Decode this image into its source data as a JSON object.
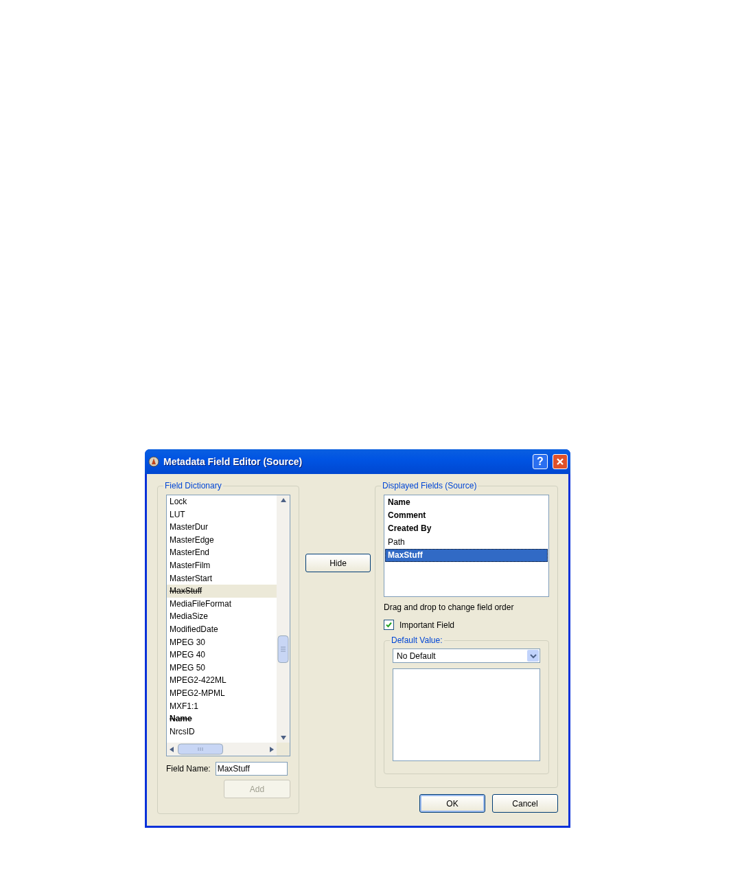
{
  "window": {
    "title": "Metadata Field Editor (Source)",
    "help_button": "?"
  },
  "field_dictionary": {
    "label": "Field Dictionary",
    "items": [
      {
        "text": "Lock",
        "bold": false,
        "struck": false,
        "selected": false
      },
      {
        "text": "LUT",
        "bold": false,
        "struck": false,
        "selected": false
      },
      {
        "text": "MasterDur",
        "bold": false,
        "struck": false,
        "selected": false
      },
      {
        "text": "MasterEdge",
        "bold": false,
        "struck": false,
        "selected": false
      },
      {
        "text": "MasterEnd",
        "bold": false,
        "struck": false,
        "selected": false
      },
      {
        "text": "MasterFilm",
        "bold": false,
        "struck": false,
        "selected": false
      },
      {
        "text": "MasterStart",
        "bold": false,
        "struck": false,
        "selected": false
      },
      {
        "text": "MaxStuff",
        "bold": false,
        "struck": true,
        "selected": true
      },
      {
        "text": "MediaFileFormat",
        "bold": false,
        "struck": false,
        "selected": false
      },
      {
        "text": "MediaSize",
        "bold": false,
        "struck": false,
        "selected": false
      },
      {
        "text": "ModifiedDate",
        "bold": false,
        "struck": false,
        "selected": false
      },
      {
        "text": "MPEG 30",
        "bold": false,
        "struck": false,
        "selected": false
      },
      {
        "text": "MPEG 40",
        "bold": false,
        "struck": false,
        "selected": false
      },
      {
        "text": "MPEG 50",
        "bold": false,
        "struck": false,
        "selected": false
      },
      {
        "text": "MPEG2-422ML",
        "bold": false,
        "struck": false,
        "selected": false
      },
      {
        "text": "MPEG2-MPML",
        "bold": false,
        "struck": false,
        "selected": false
      },
      {
        "text": "MXF1:1",
        "bold": false,
        "struck": false,
        "selected": false
      },
      {
        "text": "Name",
        "bold": true,
        "struck": true,
        "selected": false
      },
      {
        "text": "NrcsID",
        "bold": false,
        "struck": false,
        "selected": false
      }
    ],
    "field_name": {
      "label": "Field Name:",
      "value": "MaxStuff"
    },
    "add_button": {
      "label": "Add",
      "disabled": true
    }
  },
  "hide_button": "Hide",
  "displayed_fields": {
    "label": "Displayed Fields (Source)",
    "items": [
      {
        "text": "Name",
        "bold": true,
        "selected": false
      },
      {
        "text": "Comment",
        "bold": true,
        "selected": false
      },
      {
        "text": "Created By",
        "bold": true,
        "selected": false
      },
      {
        "text": "Path",
        "bold": false,
        "selected": false
      },
      {
        "text": "MaxStuff",
        "bold": true,
        "selected": true
      }
    ],
    "hint": "Drag and drop to change field order",
    "important_field": {
      "label": "Important Field",
      "checked": true
    },
    "default_value": {
      "label": "Default Value:",
      "value": "No Default"
    }
  },
  "buttons": [
    {
      "label": "OK",
      "default": true
    },
    {
      "label": "Cancel",
      "default": false
    }
  ]
}
